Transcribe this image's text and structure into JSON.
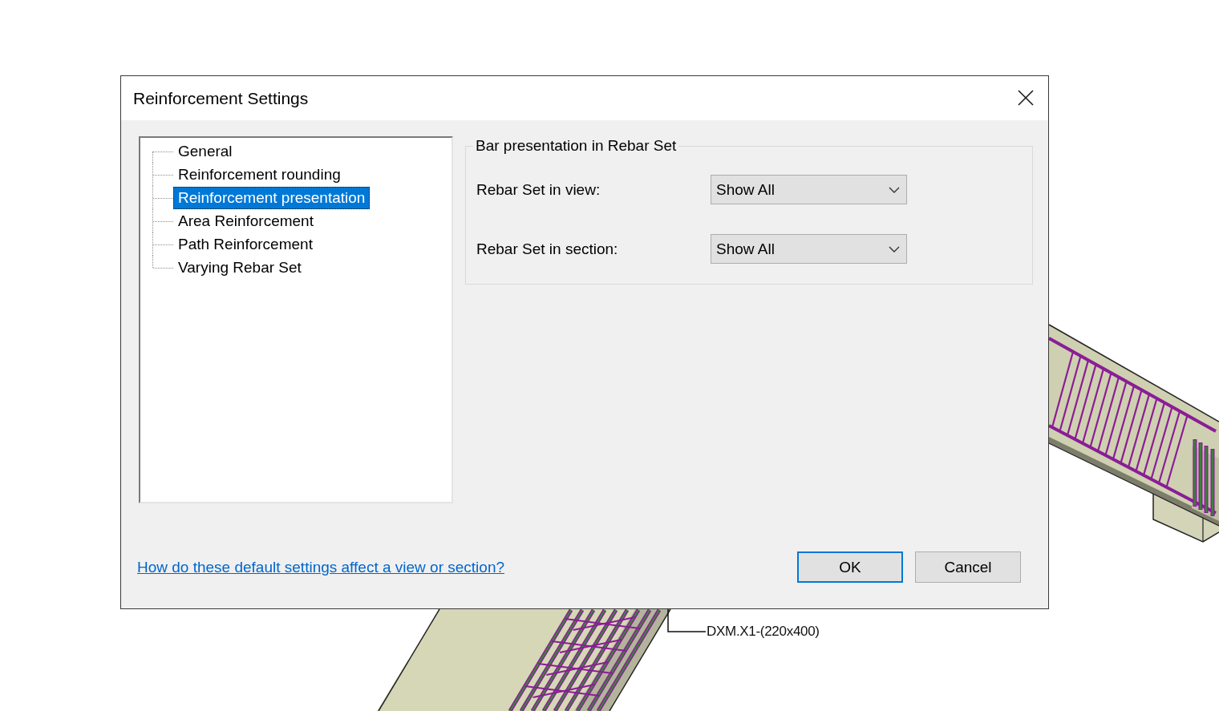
{
  "model_view": {
    "tag_label": "DXM.X1-(220x400)"
  },
  "dialog": {
    "title": "Reinforcement Settings",
    "tree": [
      {
        "label": "General",
        "selected": false
      },
      {
        "label": "Reinforcement rounding",
        "selected": false
      },
      {
        "label": "Reinforcement presentation",
        "selected": true
      },
      {
        "label": "Area Reinforcement",
        "selected": false
      },
      {
        "label": "Path Reinforcement",
        "selected": false
      },
      {
        "label": "Varying Rebar Set",
        "selected": false
      }
    ],
    "group": {
      "title": "Bar presentation in Rebar Set",
      "fields": [
        {
          "label": "Rebar Set in view:",
          "value": "Show All"
        },
        {
          "label": "Rebar Set in section:",
          "value": "Show All"
        }
      ]
    },
    "help_link": "How do these default settings affect a view or section?",
    "buttons": [
      {
        "label": "OK",
        "default": true
      },
      {
        "label": "Cancel",
        "default": false
      }
    ]
  }
}
